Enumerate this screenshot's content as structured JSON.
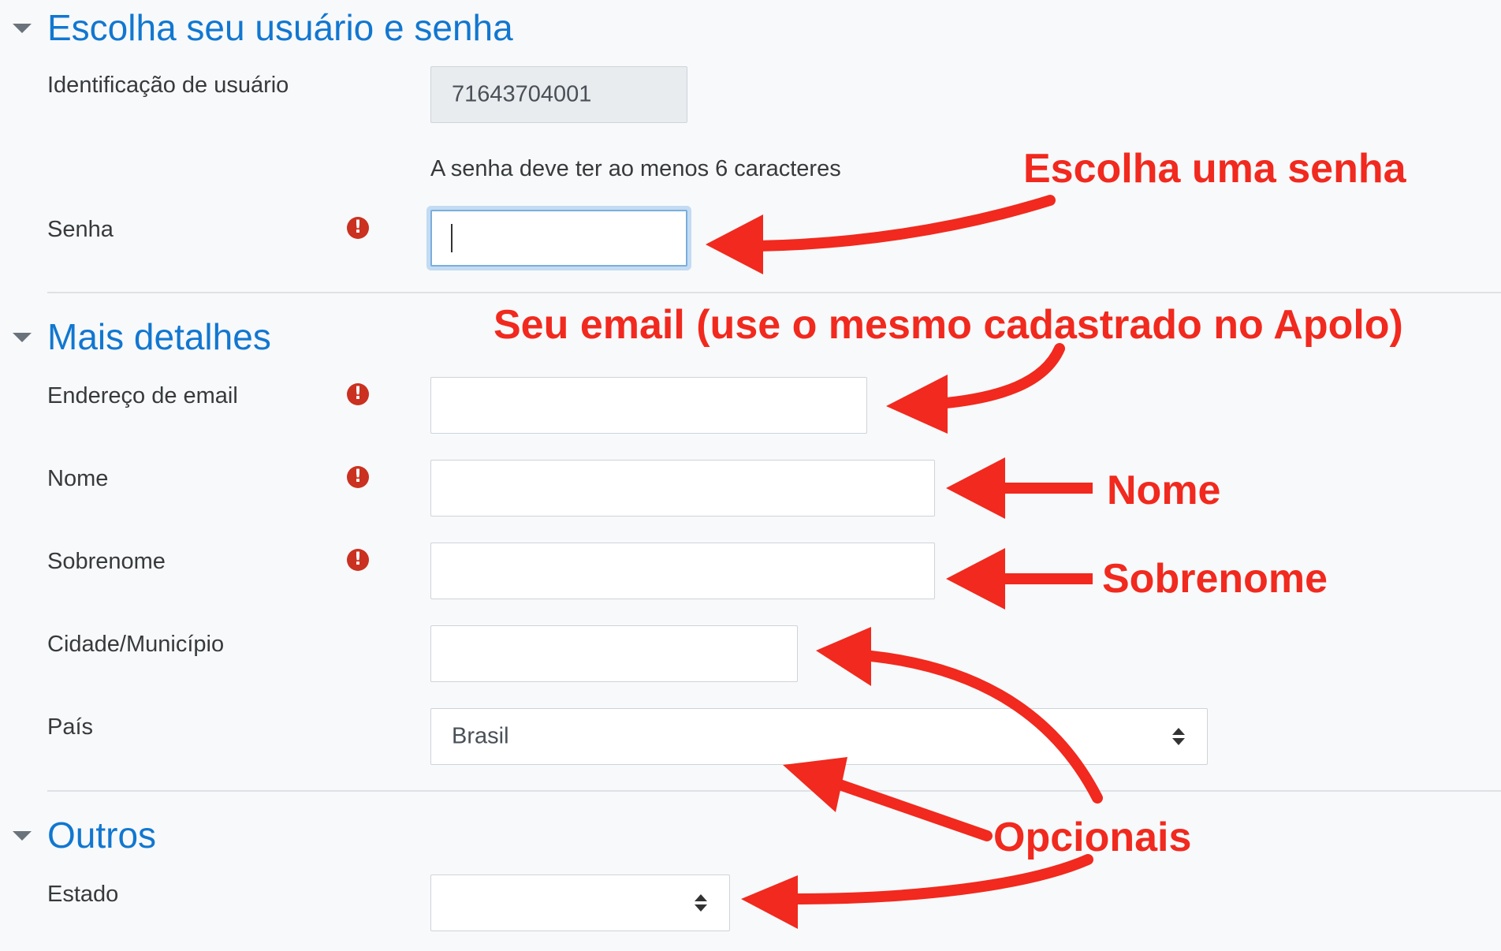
{
  "sections": {
    "credentials": {
      "title": "Escolha seu usuário e senha"
    },
    "details": {
      "title": "Mais detalhes"
    },
    "others": {
      "title": "Outros"
    }
  },
  "fields": {
    "username": {
      "label": "Identificação de usuário",
      "value": "71643704001"
    },
    "password_hint": "A senha deve ter ao menos 6 caracteres",
    "password": {
      "label": "Senha",
      "value": ""
    },
    "email": {
      "label": "Endereço de email",
      "value": ""
    },
    "firstname": {
      "label": "Nome",
      "value": ""
    },
    "lastname": {
      "label": "Sobrenome",
      "value": ""
    },
    "city": {
      "label": "Cidade/Município",
      "value": ""
    },
    "country": {
      "label": "País",
      "value": "Brasil"
    },
    "state": {
      "label": "Estado",
      "value": ""
    }
  },
  "required_icon": "!",
  "annotations": {
    "password": "Escolha uma senha",
    "email": "Seu email (use o mesmo cadastrado no Apolo)",
    "firstname": "Nome",
    "lastname": "Sobrenome",
    "optional": "Opcionais"
  },
  "colors": {
    "section_title": "#1177d1",
    "required_icon": "#ca3120",
    "annotation": "#f1291e",
    "focus_ring": "#7aaedc"
  },
  "icons": {
    "section_toggle": "caret-down-icon",
    "required": "exclamation-circle-icon",
    "select_arrows": "sort-arrows-icon"
  }
}
